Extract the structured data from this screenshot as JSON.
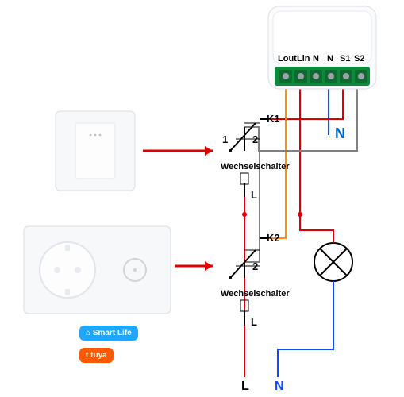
{
  "module": {
    "terminals": [
      "Lout",
      "Lin",
      "N",
      "N",
      "S1",
      "S2"
    ]
  },
  "switch1": {
    "label": "Wechselschalter",
    "k": "K1",
    "t1": "1",
    "t2": "2",
    "tl": "L"
  },
  "switch2": {
    "label": "Wechselschalter",
    "k": "K2",
    "t2": "2",
    "tl": "L"
  },
  "supply": {
    "L": "L",
    "N": "N"
  },
  "neutral_label": "N",
  "apps": {
    "smartlife": "Smart Life",
    "tuya": "tuya"
  }
}
